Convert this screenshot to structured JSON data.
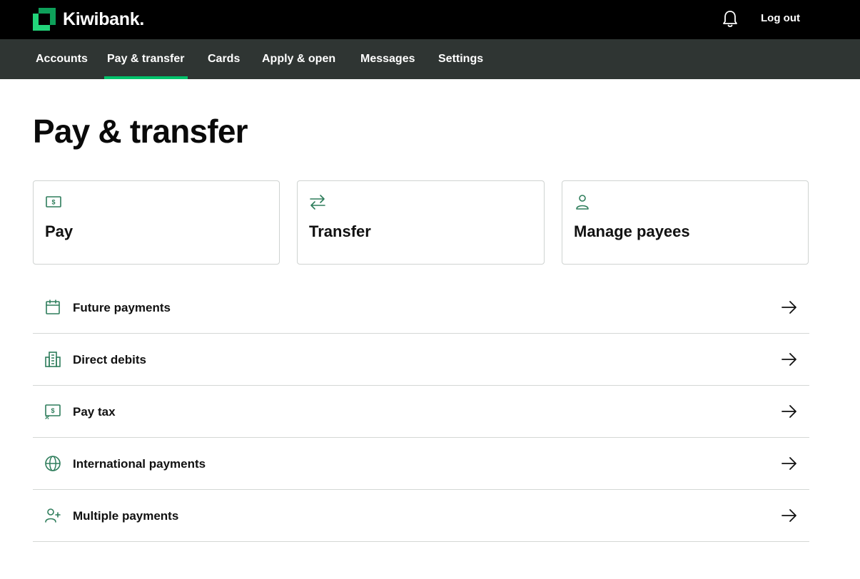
{
  "brand": {
    "name": "Kiwibank.",
    "accent_color": "#00c26b"
  },
  "header": {
    "notification_icon": "bell-icon",
    "logout_label": "Log out"
  },
  "nav": {
    "items": [
      {
        "label": "Accounts",
        "active": false
      },
      {
        "label": "Pay & transfer",
        "active": true
      },
      {
        "label": "Cards",
        "active": false
      },
      {
        "label": "Apply & open",
        "active": false
      },
      {
        "label": "Messages",
        "active": false
      },
      {
        "label": "Settings",
        "active": false
      }
    ]
  },
  "page": {
    "title": "Pay & transfer"
  },
  "tiles": [
    {
      "label": "Pay",
      "icon": "money-note-icon"
    },
    {
      "label": "Transfer",
      "icon": "transfer-arrows-icon"
    },
    {
      "label": "Manage payees",
      "icon": "person-icon"
    }
  ],
  "list": [
    {
      "label": "Future payments",
      "icon": "calendar-icon"
    },
    {
      "label": "Direct debits",
      "icon": "building-icon"
    },
    {
      "label": "Pay tax",
      "icon": "tax-note-icon"
    },
    {
      "label": "International payments",
      "icon": "globe-icon"
    },
    {
      "label": "Multiple payments",
      "icon": "add-person-icon"
    }
  ],
  "icon_color": "#2e7d5b"
}
